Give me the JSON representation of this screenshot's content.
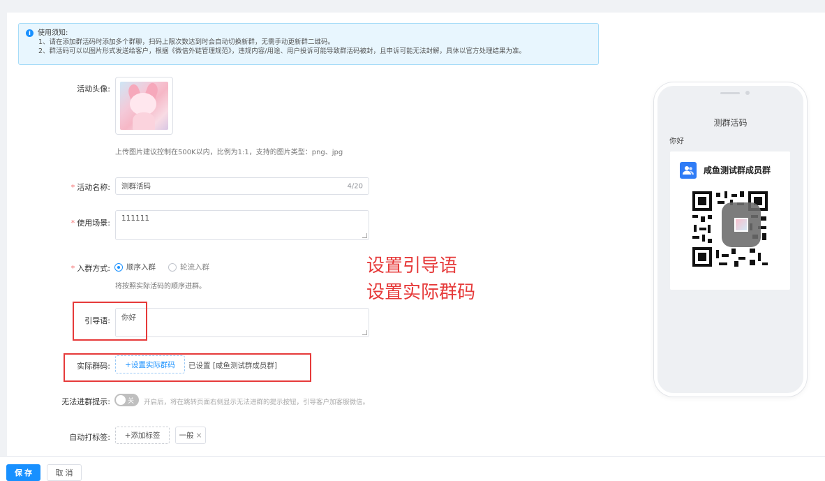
{
  "notice": {
    "title": "使用须知:",
    "line1": "1、请在添加群活码时添加多个群聊，扫码上限次数达到时会自动切换新群，无需手动更新群二维码。",
    "line2": "2、群活码可以以图片形式发送给客户，根据《微信外链管理规范》，违规内容/用途、用户投诉可能导致群活码被封，且申诉可能无法封解，具体以官方处理结果为准。"
  },
  "form": {
    "avatar_label": "活动头像:",
    "avatar_hint": "上传图片建议控制在500K以内，比例为1:1，支持的图片类型：png、jpg",
    "name_label": "活动名称:",
    "name_value": "测群活码",
    "name_count": "4/20",
    "scene_label": "使用场景:",
    "scene_value": "111111",
    "join_label": "入群方式:",
    "join_option1": "顺序入群",
    "join_option2": "轮流入群",
    "join_hint": "将按照实际活码的顺序进群。",
    "guide_label": "引导语:",
    "guide_value": "你好",
    "code_label": "实际群码:",
    "code_button": "+设置实际群码",
    "code_status": "已设置 [咸鱼测试群成员群]",
    "noentry_label": "无法进群提示:",
    "switch_text": "关",
    "noentry_hint": "开启后，将在跳转页面右侧显示无法进群的提示按钮，引导客户加客服微信。",
    "tag_label": "自动打标签:",
    "tag_button": "+添加标签",
    "tag_value": "一般",
    "tag_close": "×"
  },
  "annotation": {
    "line1": "设置引导语",
    "line2": "设置实际群码",
    "color": "#e63a3a"
  },
  "preview": {
    "title": "测群活码",
    "greeting": "你好",
    "group_name": "咸鱼测试群成员群",
    "group_icon": "group-users-icon"
  },
  "footer": {
    "save": "保 存",
    "cancel": "取 消"
  },
  "colors": {
    "primary": "#1890ff",
    "required": "#f56c6c"
  }
}
